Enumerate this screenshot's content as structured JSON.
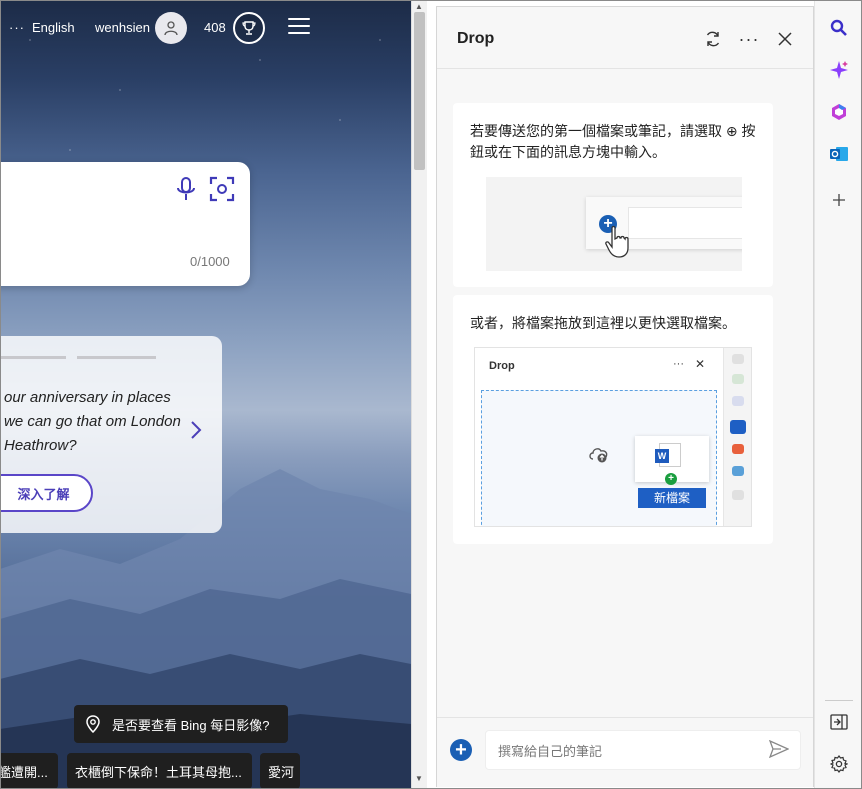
{
  "bing": {
    "more": "···",
    "language": "English",
    "username": "wenhsien",
    "points": "408",
    "search_counter": "0/1000",
    "card_text": "our anniversary in places we can go that om London Heathrow?",
    "card_button": "深入了解",
    "toast_text": "是否要查看 Bing 每日影像?",
    "news": [
      "艦遭開...",
      "衣櫃倒下保命！土耳其母抱...",
      "愛河"
    ]
  },
  "drop": {
    "title": "Drop",
    "tip1": "若要傳送您的第一個檔案或筆記，請選取 ⊕ 按鈕或在下面的訊息方塊中輸入。",
    "tip2": "或者，將檔案拖放到這裡以更快選取檔案。",
    "mini_title": "Drop",
    "mini_more": "···",
    "mini_close": "✕",
    "new_file_label": "新檔案",
    "input_placeholder": "撰寫給自己的筆記"
  },
  "sidebar": {
    "icons": [
      "search-icon",
      "copilot-icon",
      "office-icon",
      "outlook-icon",
      "add-icon",
      "split-screen-icon",
      "settings-icon"
    ]
  },
  "colors": {
    "accent": "#1a5fb4",
    "bing_button": "#5a46c8"
  }
}
